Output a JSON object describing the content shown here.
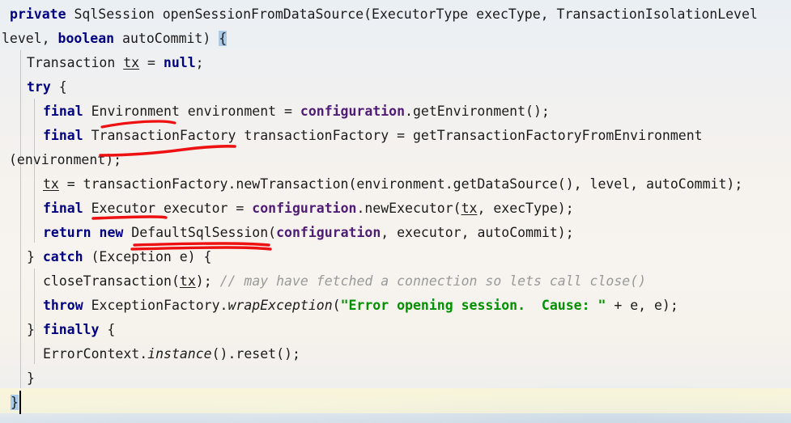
{
  "editor": {
    "language": "java",
    "background_color": "#eef1f5",
    "current_line_highlight_color": "#faf6d6",
    "brace_match_highlight_color": "#a9cbe9",
    "colors": {
      "keyword": "#000080",
      "field": "#4f1d75",
      "string": "#009000",
      "comment": "#9a9a9a",
      "text": "#1b1b1b",
      "annotation_red": "#ee1111",
      "indent_guide": "#c3c7cb"
    },
    "lines": [
      {
        "n": 1,
        "indent": 1,
        "text": "private SqlSession openSessionFromDataSource(ExecutorType execType, TransactionIsolationLevel"
      },
      {
        "n": 2,
        "indent": 0,
        "text": "level, boolean autoCommit) {"
      },
      {
        "n": 3,
        "indent": 2,
        "text": "Transaction tx = null;"
      },
      {
        "n": 4,
        "indent": 2,
        "text": "try {"
      },
      {
        "n": 5,
        "indent": 4,
        "text": "final Environment environment = configuration.getEnvironment();"
      },
      {
        "n": 6,
        "indent": 4,
        "text": "final TransactionFactory transactionFactory = getTransactionFactoryFromEnvironment"
      },
      {
        "n": 7,
        "indent": 0,
        "text": "(environment);"
      },
      {
        "n": 8,
        "indent": 4,
        "text": "tx = transactionFactory.newTransaction(environment.getDataSource(), level, autoCommit);"
      },
      {
        "n": 9,
        "indent": 4,
        "text": "final Executor executor = configuration.newExecutor(tx, execType);"
      },
      {
        "n": 10,
        "indent": 4,
        "text": "return new DefaultSqlSession(configuration, executor, autoCommit);"
      },
      {
        "n": 11,
        "indent": 2,
        "text": "} catch (Exception e) {"
      },
      {
        "n": 12,
        "indent": 4,
        "text": "closeTransaction(tx); // may have fetched a connection so lets call close()"
      },
      {
        "n": 13,
        "indent": 4,
        "text": "throw ExceptionFactory.wrapException(\"Error opening session.  Cause: \" + e, e);"
      },
      {
        "n": 14,
        "indent": 2,
        "text": "} finally {"
      },
      {
        "n": 15,
        "indent": 4,
        "text": "ErrorContext.instance().reset();"
      },
      {
        "n": 16,
        "indent": 2,
        "text": "}"
      },
      {
        "n": 17,
        "indent": 0,
        "text": "}"
      }
    ],
    "tokens": {
      "keywords": [
        "private",
        "boolean",
        "try",
        "final",
        "return",
        "new",
        "catch",
        "throw",
        "finally"
      ],
      "fields": [
        "configuration"
      ],
      "string_literal": "\"Error opening session.  Cause: \"",
      "comment": "// may have fetched a connection so lets call close()",
      "italic_methods": [
        "wrapException",
        "instance"
      ],
      "underlined_variables": [
        "tx"
      ]
    },
    "caret": {
      "line": 17,
      "column": 2
    },
    "matched_braces": [
      "{",
      "}"
    ],
    "annotations": [
      {
        "id": 1,
        "label": "underline-environment-type",
        "target": "Environment"
      },
      {
        "id": 2,
        "label": "underline-transactionfactory-type",
        "target": "TransactionFactory"
      },
      {
        "id": 3,
        "label": "underline-executor-type",
        "target": "Executor"
      },
      {
        "id": 4,
        "label": "underline-defaultsqlsession-type",
        "target": "DefaultSqlSession"
      },
      {
        "id": 5,
        "label": "underline-exception-type",
        "target": "Exception"
      }
    ]
  }
}
